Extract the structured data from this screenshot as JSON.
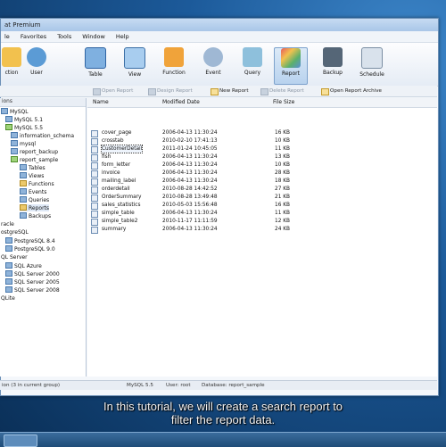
{
  "window": {
    "title": "at Premium"
  },
  "menu": [
    "le",
    "Favorites",
    "Tools",
    "Window",
    "Help"
  ],
  "toolbar": {
    "buttons": [
      "ction",
      "User",
      "Table",
      "View",
      "Function",
      "Event",
      "Query",
      "Report",
      "Backup",
      "Schedule"
    ],
    "active": "Report"
  },
  "object_bar": [
    "Open Report",
    "Design Report",
    "New Report",
    "Delete Report",
    "Open Report Archive"
  ],
  "sidebar": {
    "header": "ions",
    "tree": [
      "MySQL",
      "MySQL 5.1",
      "MySQL 5.5",
      "information_schema",
      "mysql",
      "report_backup",
      "report_sample",
      "Tables",
      "Views",
      "Functions",
      "Events",
      "Queries",
      "Reports",
      "Backups",
      "racle",
      "ostgreSQL",
      "PostgreSQL 8.4",
      "PostgreSQL 9.0",
      "QL Server",
      "SQL Azure",
      "SQL Server 2000",
      "SQL Server 2005",
      "SQL Server 2008",
      "QLite"
    ]
  },
  "list": {
    "columns": [
      "Name",
      "Modified Date",
      "File Size"
    ],
    "rows": [
      {
        "name": "cover_page",
        "date": "2006-04-13 11:30:24",
        "size": "16 KB"
      },
      {
        "name": "crosstab",
        "date": "2010-02-10 17:41:13",
        "size": "10 KB"
      },
      {
        "name": "CustomerDetail",
        "date": "2011-01-24 10:45:05",
        "size": "11 KB"
      },
      {
        "name": "fish",
        "date": "2006-04-13 11:30:24",
        "size": "13 KB"
      },
      {
        "name": "form_letter",
        "date": "2006-04-13 11:30:24",
        "size": "10 KB"
      },
      {
        "name": "invoice",
        "date": "2006-04-13 11:30:24",
        "size": "28 KB"
      },
      {
        "name": "mailing_label",
        "date": "2006-04-13 11:30:24",
        "size": "18 KB"
      },
      {
        "name": "orderdetail",
        "date": "2010-08-28 14:42:52",
        "size": "27 KB"
      },
      {
        "name": "OrderSummary",
        "date": "2010-08-28 13:49:48",
        "size": "21 KB"
      },
      {
        "name": "sales_statistics",
        "date": "2010-05-03 15:56:48",
        "size": "16 KB"
      },
      {
        "name": "simple_table",
        "date": "2006-04-13 11:30:24",
        "size": "11 KB"
      },
      {
        "name": "simple_table2",
        "date": "2010-11-17 11:11:59",
        "size": "12 KB"
      },
      {
        "name": "summary",
        "date": "2006-04-13 11:30:24",
        "size": "24 KB"
      }
    ],
    "selected_index": 2
  },
  "status": {
    "left": "ion (3 in current group)",
    "server": "MySQL 5.5",
    "user": "User: root",
    "database": "Database: report_sample"
  },
  "subtitle": {
    "line1": "In this tutorial, we will create a search report to",
    "line2": "filter the report data."
  }
}
